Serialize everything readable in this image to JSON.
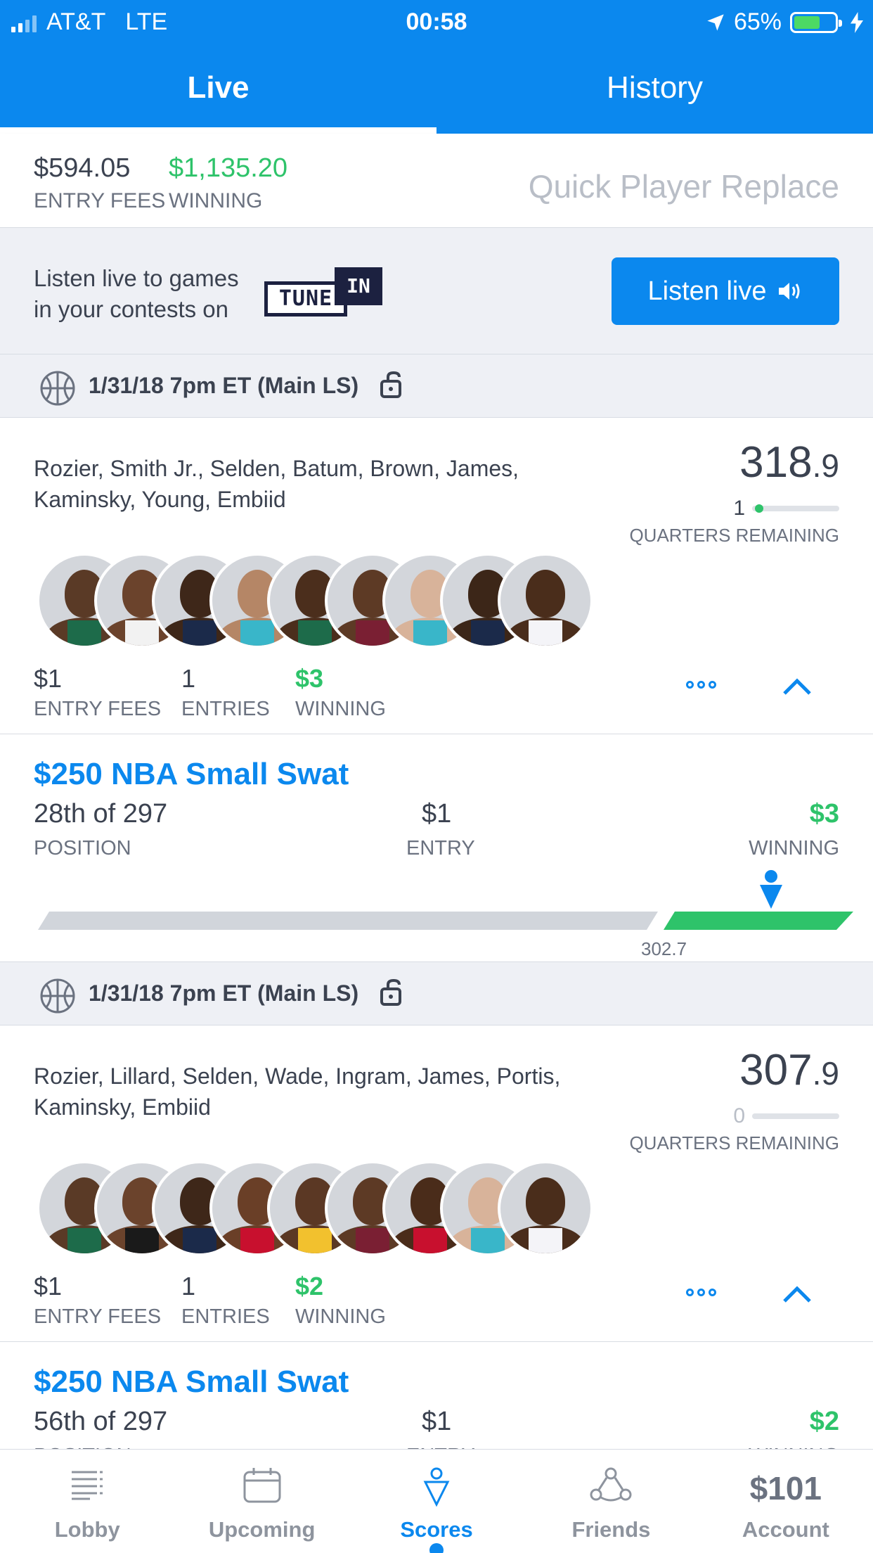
{
  "status": {
    "carrier": "AT&T",
    "network": "LTE",
    "time": "00:58",
    "battery": "65%",
    "battery_level": 0.65
  },
  "tabs": [
    {
      "label": "Live",
      "active": true
    },
    {
      "label": "History",
      "active": false
    }
  ],
  "summary": {
    "entry_fees_value": "$594.05",
    "entry_fees_label": "ENTRY FEES",
    "winning_value": "$1,135.20",
    "winning_label": "WINNING",
    "quick_replace": "Quick Player Replace"
  },
  "banner": {
    "line1": "Listen live to games",
    "line2": "in your contests on",
    "logo_tune": "TUNE",
    "logo_in": "IN",
    "button": "Listen live"
  },
  "lineups": [
    {
      "slate": "1/31/18 7pm ET (Main LS)",
      "players_line1": "Rozier, Smith Jr., Selden, Batum, Brown, James,",
      "players_line2": "Kaminsky, Young, Embiid",
      "score_main": "318",
      "score_dec": ".9",
      "quarters": "1",
      "quarters_label": "QUARTERS REMAINING",
      "entry_fees": "$1",
      "entry_fees_label": "ENTRY FEES",
      "entries": "1",
      "entries_label": "ENTRIES",
      "winning": "$3",
      "winning_label": "WINNING",
      "contest": {
        "name": "$250 NBA Small Swat",
        "position": "28th of 297",
        "position_label": "POSITION",
        "entry": "$1",
        "entry_label": "ENTRY",
        "winning": "$3",
        "winning_label": "WINNING",
        "cutoff": "302.7"
      }
    },
    {
      "slate": "1/31/18 7pm ET (Main LS)",
      "players_line1": "Rozier, Lillard, Selden, Wade, Ingram, James, Portis,",
      "players_line2": "Kaminsky, Embiid",
      "score_main": "307",
      "score_dec": ".9",
      "quarters": "0",
      "quarters_label": "QUARTERS REMAINING",
      "entry_fees": "$1",
      "entry_fees_label": "ENTRY FEES",
      "entries": "1",
      "entries_label": "ENTRIES",
      "winning": "$2",
      "winning_label": "WINNING",
      "contest": {
        "name": "$250 NBA Small Swat",
        "position": "56th of 297",
        "position_label": "POSITION",
        "entry": "$1",
        "entry_label": "ENTRY",
        "winning": "$2",
        "winning_label": "WINNING"
      }
    }
  ],
  "tabbar": [
    {
      "label": "Lobby",
      "icon": "list-icon"
    },
    {
      "label": "Upcoming",
      "icon": "calendar-icon"
    },
    {
      "label": "Scores",
      "icon": "scores-icon",
      "active": true
    },
    {
      "label": "Friends",
      "icon": "friends-icon"
    },
    {
      "label": "Account",
      "money": "$101"
    }
  ],
  "colors": {
    "brand": "#0b88ee",
    "green": "#2ec36a",
    "text": "#3b4250",
    "muted": "#6b7280"
  }
}
